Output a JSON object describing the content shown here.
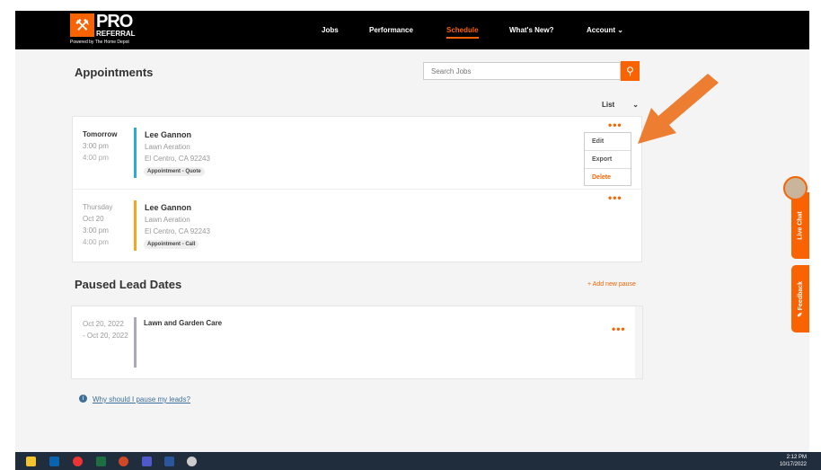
{
  "brand": {
    "name": "PRO",
    "sub": "REFERRAL",
    "powered": "Powered by The Home Depot"
  },
  "nav": {
    "items": [
      "Jobs",
      "Performance",
      "Schedule",
      "What's New?",
      "Account ⌄"
    ],
    "active": "Schedule"
  },
  "page": {
    "title": "Appointments",
    "search_placeholder": "Search Jobs",
    "view": "List"
  },
  "appointments": [
    {
      "day": "Tomorrow",
      "date": "",
      "start": "3:00 pm",
      "end": "4:00 pm",
      "name": "Lee Gannon",
      "service": "Lawn Aeration",
      "location": "El Centro, CA 92243",
      "type": "Appointment - Quote",
      "color": "#29abe2"
    },
    {
      "day": "Thursday",
      "date": "Oct 20",
      "start": "3:00 pm",
      "end": "4:00 pm",
      "name": "Lee Gannon",
      "service": "Lawn Aeration",
      "location": "El Centro, CA 92243",
      "type": "Appointment - Call",
      "color": "#f5a623"
    }
  ],
  "menu": {
    "items": [
      "Edit",
      "Export",
      "Delete"
    ]
  },
  "paused": {
    "title": "Paused Lead Dates",
    "add": "+ Add new pause",
    "from": "Oct 20, 2022",
    "to": "- Oct 20, 2022",
    "category": "Lawn and Garden Care",
    "help": "Why should I pause my leads?"
  },
  "side": {
    "chat": "Live Chat",
    "feedback": "✎ Feedback"
  },
  "clock": {
    "time": "2:12 PM",
    "date": "10/17/2022"
  },
  "accent": "#f96302"
}
